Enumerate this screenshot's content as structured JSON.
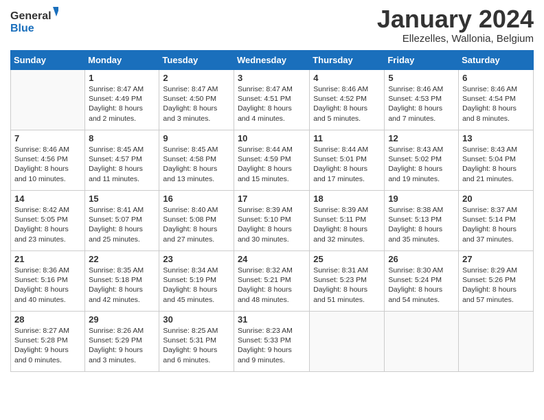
{
  "logo": {
    "general": "General",
    "blue": "Blue"
  },
  "header": {
    "month": "January 2024",
    "location": "Ellezelles, Wallonia, Belgium"
  },
  "days_of_week": [
    "Sunday",
    "Monday",
    "Tuesday",
    "Wednesday",
    "Thursday",
    "Friday",
    "Saturday"
  ],
  "weeks": [
    [
      {
        "day": "",
        "info": ""
      },
      {
        "day": "1",
        "info": "Sunrise: 8:47 AM\nSunset: 4:49 PM\nDaylight: 8 hours\nand 2 minutes."
      },
      {
        "day": "2",
        "info": "Sunrise: 8:47 AM\nSunset: 4:50 PM\nDaylight: 8 hours\nand 3 minutes."
      },
      {
        "day": "3",
        "info": "Sunrise: 8:47 AM\nSunset: 4:51 PM\nDaylight: 8 hours\nand 4 minutes."
      },
      {
        "day": "4",
        "info": "Sunrise: 8:46 AM\nSunset: 4:52 PM\nDaylight: 8 hours\nand 5 minutes."
      },
      {
        "day": "5",
        "info": "Sunrise: 8:46 AM\nSunset: 4:53 PM\nDaylight: 8 hours\nand 7 minutes."
      },
      {
        "day": "6",
        "info": "Sunrise: 8:46 AM\nSunset: 4:54 PM\nDaylight: 8 hours\nand 8 minutes."
      }
    ],
    [
      {
        "day": "7",
        "info": "Sunrise: 8:46 AM\nSunset: 4:56 PM\nDaylight: 8 hours\nand 10 minutes."
      },
      {
        "day": "8",
        "info": "Sunrise: 8:45 AM\nSunset: 4:57 PM\nDaylight: 8 hours\nand 11 minutes."
      },
      {
        "day": "9",
        "info": "Sunrise: 8:45 AM\nSunset: 4:58 PM\nDaylight: 8 hours\nand 13 minutes."
      },
      {
        "day": "10",
        "info": "Sunrise: 8:44 AM\nSunset: 4:59 PM\nDaylight: 8 hours\nand 15 minutes."
      },
      {
        "day": "11",
        "info": "Sunrise: 8:44 AM\nSunset: 5:01 PM\nDaylight: 8 hours\nand 17 minutes."
      },
      {
        "day": "12",
        "info": "Sunrise: 8:43 AM\nSunset: 5:02 PM\nDaylight: 8 hours\nand 19 minutes."
      },
      {
        "day": "13",
        "info": "Sunrise: 8:43 AM\nSunset: 5:04 PM\nDaylight: 8 hours\nand 21 minutes."
      }
    ],
    [
      {
        "day": "14",
        "info": "Sunrise: 8:42 AM\nSunset: 5:05 PM\nDaylight: 8 hours\nand 23 minutes."
      },
      {
        "day": "15",
        "info": "Sunrise: 8:41 AM\nSunset: 5:07 PM\nDaylight: 8 hours\nand 25 minutes."
      },
      {
        "day": "16",
        "info": "Sunrise: 8:40 AM\nSunset: 5:08 PM\nDaylight: 8 hours\nand 27 minutes."
      },
      {
        "day": "17",
        "info": "Sunrise: 8:39 AM\nSunset: 5:10 PM\nDaylight: 8 hours\nand 30 minutes."
      },
      {
        "day": "18",
        "info": "Sunrise: 8:39 AM\nSunset: 5:11 PM\nDaylight: 8 hours\nand 32 minutes."
      },
      {
        "day": "19",
        "info": "Sunrise: 8:38 AM\nSunset: 5:13 PM\nDaylight: 8 hours\nand 35 minutes."
      },
      {
        "day": "20",
        "info": "Sunrise: 8:37 AM\nSunset: 5:14 PM\nDaylight: 8 hours\nand 37 minutes."
      }
    ],
    [
      {
        "day": "21",
        "info": "Sunrise: 8:36 AM\nSunset: 5:16 PM\nDaylight: 8 hours\nand 40 minutes."
      },
      {
        "day": "22",
        "info": "Sunrise: 8:35 AM\nSunset: 5:18 PM\nDaylight: 8 hours\nand 42 minutes."
      },
      {
        "day": "23",
        "info": "Sunrise: 8:34 AM\nSunset: 5:19 PM\nDaylight: 8 hours\nand 45 minutes."
      },
      {
        "day": "24",
        "info": "Sunrise: 8:32 AM\nSunset: 5:21 PM\nDaylight: 8 hours\nand 48 minutes."
      },
      {
        "day": "25",
        "info": "Sunrise: 8:31 AM\nSunset: 5:23 PM\nDaylight: 8 hours\nand 51 minutes."
      },
      {
        "day": "26",
        "info": "Sunrise: 8:30 AM\nSunset: 5:24 PM\nDaylight: 8 hours\nand 54 minutes."
      },
      {
        "day": "27",
        "info": "Sunrise: 8:29 AM\nSunset: 5:26 PM\nDaylight: 8 hours\nand 57 minutes."
      }
    ],
    [
      {
        "day": "28",
        "info": "Sunrise: 8:27 AM\nSunset: 5:28 PM\nDaylight: 9 hours\nand 0 minutes."
      },
      {
        "day": "29",
        "info": "Sunrise: 8:26 AM\nSunset: 5:29 PM\nDaylight: 9 hours\nand 3 minutes."
      },
      {
        "day": "30",
        "info": "Sunrise: 8:25 AM\nSunset: 5:31 PM\nDaylight: 9 hours\nand 6 minutes."
      },
      {
        "day": "31",
        "info": "Sunrise: 8:23 AM\nSunset: 5:33 PM\nDaylight: 9 hours\nand 9 minutes."
      },
      {
        "day": "",
        "info": ""
      },
      {
        "day": "",
        "info": ""
      },
      {
        "day": "",
        "info": ""
      }
    ]
  ]
}
